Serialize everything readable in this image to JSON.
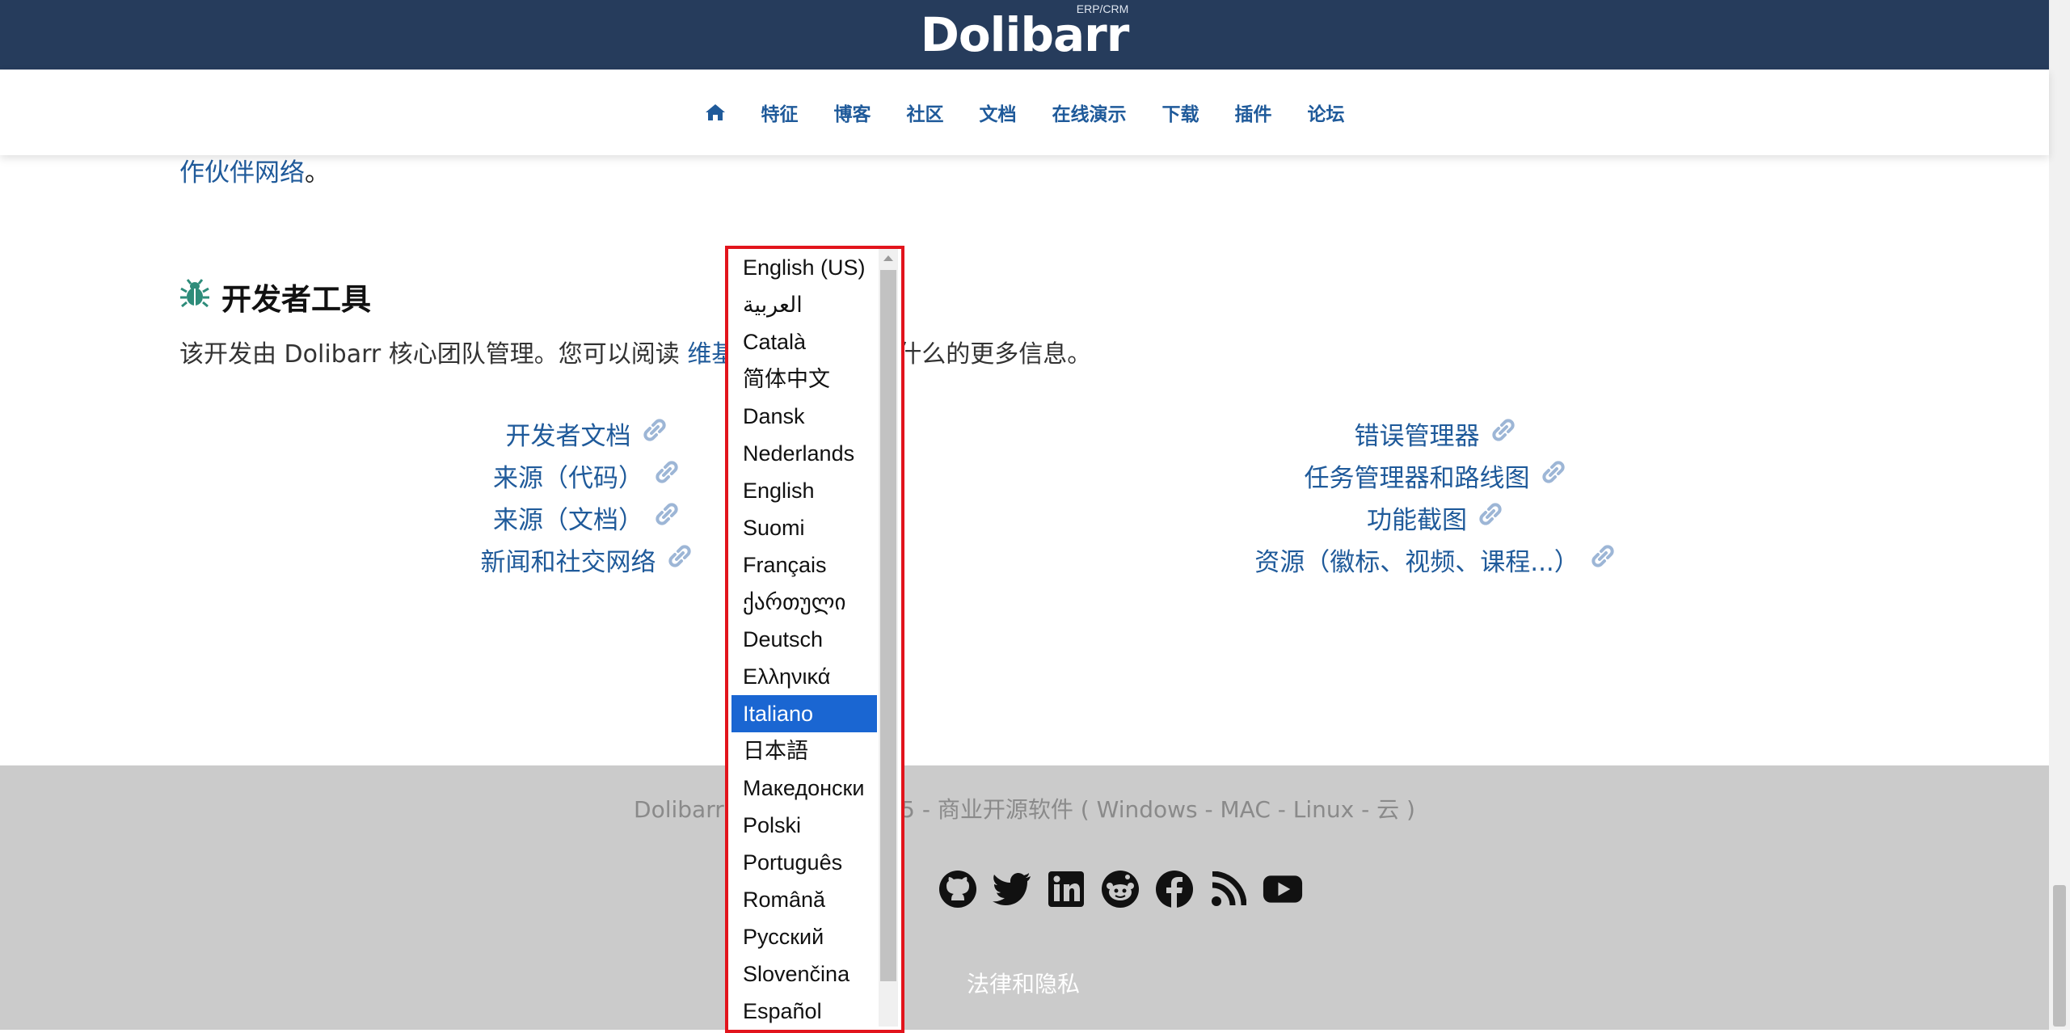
{
  "brand": {
    "name": "Dolibarr",
    "sub": "ERP/CRM"
  },
  "nav": {
    "home_icon": "home-icon",
    "items": [
      "特征",
      "博客",
      "社区",
      "文档",
      "在线演示",
      "下载",
      "插件",
      "论坛"
    ]
  },
  "intro": {
    "tail_text": "作伙伴网络",
    "tail_punct": "。"
  },
  "dev_section": {
    "icon": "bug-icon",
    "title": "开发者工具",
    "desc_before": "该开发由 Dolibarr 核心团队管理。您可以阅读 ",
    "desc_link": "维基",
    "desc_after": "谁做什么的更多信息。",
    "left_links": [
      "开发者文档",
      "来源（代码）",
      "来源（文档）",
      "新闻和社交网络"
    ],
    "right_links": [
      "错误管理器",
      "任务管理器和路线图",
      "功能截图",
      "资源（徽标、视频、课程...）"
    ],
    "link_icon": "link-icon"
  },
  "footer": {
    "copyright_start": "Dolibarr",
    "copyright_end": "2025 - 商业开源软件 ( Windows - MAC - Linux - 云 )",
    "social_icons": [
      "github-icon",
      "twitter-icon",
      "linkedin-icon",
      "reddit-icon",
      "facebook-icon",
      "rss-icon",
      "youtube-icon"
    ],
    "legal": "法律和隐私"
  },
  "language_dropdown": {
    "selected": "Italiano",
    "options": [
      "English (US)",
      "العربية",
      "Català",
      "简体中文",
      "Dansk",
      "Nederlands",
      "English",
      "Suomi",
      "Français",
      "ქართული",
      "Deutsch",
      "Ελληνικά",
      "Italiano",
      "日本語",
      "Македонски",
      "Polski",
      "Português",
      "Română",
      "Русский",
      "Slovenčina",
      "Español"
    ]
  },
  "colors": {
    "brand_bar": "#263c5c",
    "link": "#1f5a9a",
    "highlight_border": "#e2141c",
    "selected_option": "#1a66d2",
    "footer_bg": "#cbcbcb"
  }
}
